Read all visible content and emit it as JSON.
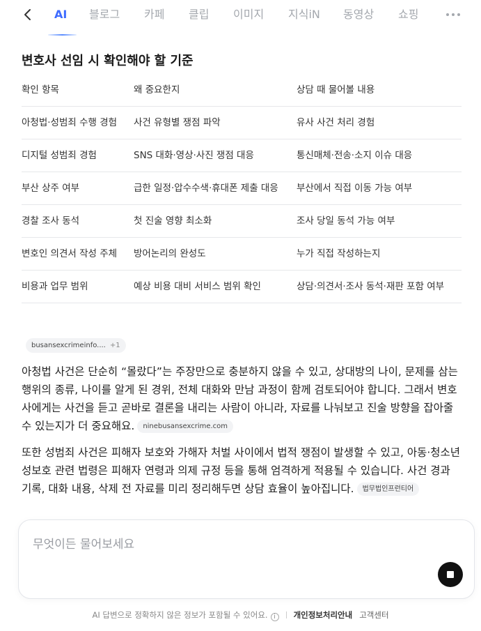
{
  "nav": {
    "tabs": [
      "AI",
      "블로그",
      "카페",
      "클립",
      "이미지",
      "지식iN",
      "동영상",
      "쇼핑"
    ],
    "active_tab": "AI"
  },
  "section_title": "변호사 선임 시 확인해야 할 기준",
  "table": {
    "headers": [
      "확인 항목",
      "왜 중요한지",
      "상담 때 물어볼 내용"
    ],
    "rows": [
      [
        "아청법·성범죄 수행 경험",
        "사건 유형별 쟁점 파악",
        "유사 사건 처리 경험"
      ],
      [
        "디지털 성범죄 경험",
        "SNS 대화·영상·사진 쟁점 대응",
        "통신매체·전송·소지 이슈 대응"
      ],
      [
        "부산 상주 여부",
        "급한 일정·압수수색·휴대폰 제출 대응",
        "부산에서 직접 이동 가능 여부"
      ],
      [
        "경찰 조사 동석",
        "첫 진술 영향 최소화",
        "조사 당일 동석 가능 여부"
      ],
      [
        "변호인 의견서 작성 주체",
        "방어논리의 완성도",
        "누가 직접 작성하는지"
      ],
      [
        "비용과 업무 범위",
        "예상 비용 대비 서비스 범위 확인",
        "상담·의견서·조사 동석·재판 포함 여부"
      ]
    ]
  },
  "source_chip": {
    "label": "busansexcrimeinfo....",
    "count": "+1"
  },
  "paragraphs": [
    {
      "text": "아청법 사건은 단순히 “몰랐다”는 주장만으로 충분하지 않을 수 있고, 상대방의 나이, 문제를 삼는 행위의 종류, 나이를 알게 된 경위, 전체 대화와 만남 과정이 함께 검토되어야 합니다. 그래서 변호사에게는 사건을 듣고 곧바로 결론을 내리는 사람이 아니라, 자료를 나눠보고 진술 방향을 잡아줄 수 있는지가 더 중요해요.",
      "source": "ninebusansexcrime.com"
    },
    {
      "text": "또한 성범죄 사건은 피해자 보호와 가해자 처벌 사이에서 법적 쟁점이 발생할 수 있고, 아동·청소년 성보호 관련 법령은 피해자 연령과 의제 규정 등을 통해 엄격하게 적용될 수 있습니다. 사건 경과 기록, 대화 내용, 삭제 전 자료를 미리 정리해두면 상담 효율이 높아집니다.",
      "source": "법무법인프런티어"
    }
  ],
  "input": {
    "placeholder": "무엇이든 물어보세요"
  },
  "footer": {
    "disclaimer": "AI 답변으로 정확하지 않은 정보가 포함될 수 있어요.",
    "privacy": "개인정보처리안내",
    "help": "고객센터"
  }
}
